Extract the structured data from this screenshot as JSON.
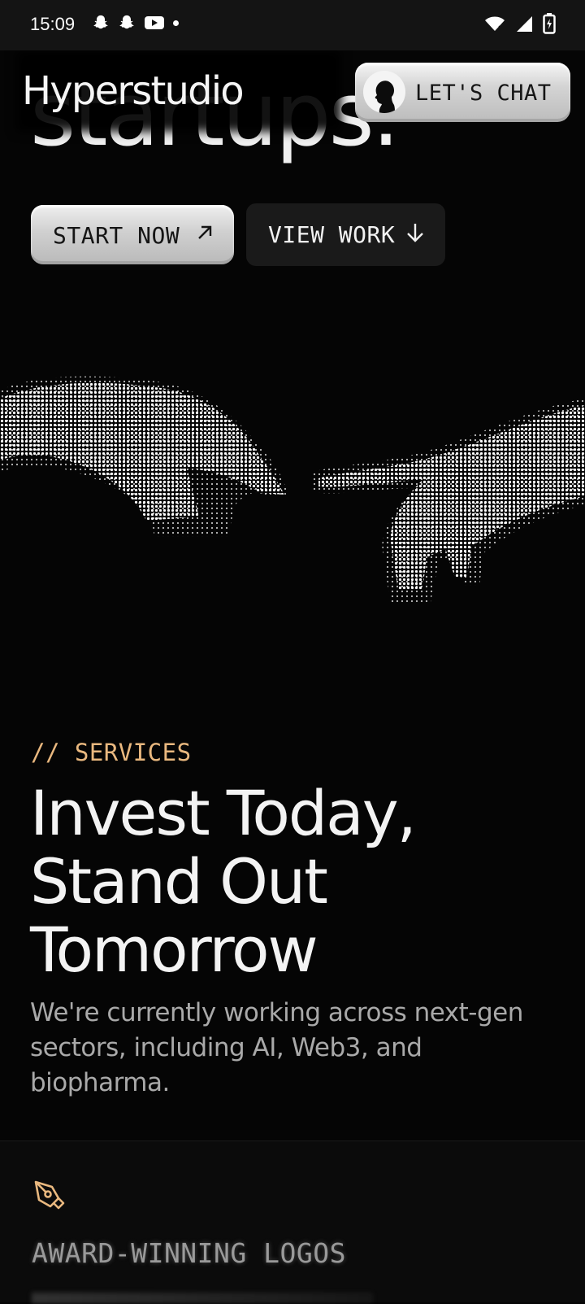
{
  "status_bar": {
    "time": "15:09",
    "left_icons": [
      "snapchat-icon",
      "snapchat-icon",
      "youtube-icon",
      "notification-dot-icon"
    ],
    "right_icons": [
      "wifi-icon",
      "signal-icon",
      "battery-charging-icon"
    ]
  },
  "nav": {
    "logo": "Hyperstudio",
    "chat_button": "LET'S CHAT"
  },
  "hero": {
    "partial_heading": "startups.",
    "start_button": "START NOW",
    "view_button": "VIEW WORK"
  },
  "services": {
    "tag": "// SERVICES",
    "title_lines": [
      "Invest Today,",
      "Stand Out",
      "Tomorrow"
    ],
    "description": "We're currently working across next-gen sectors, including AI, Web3, and biopharma."
  },
  "card": {
    "icon": "pen-nib-icon",
    "title": "AWARD-WINNING LOGOS"
  },
  "colors": {
    "background": "#050505",
    "accent": "#e9b87f",
    "button_light": "#d0d0d0",
    "button_dark": "#1a1a1a"
  }
}
